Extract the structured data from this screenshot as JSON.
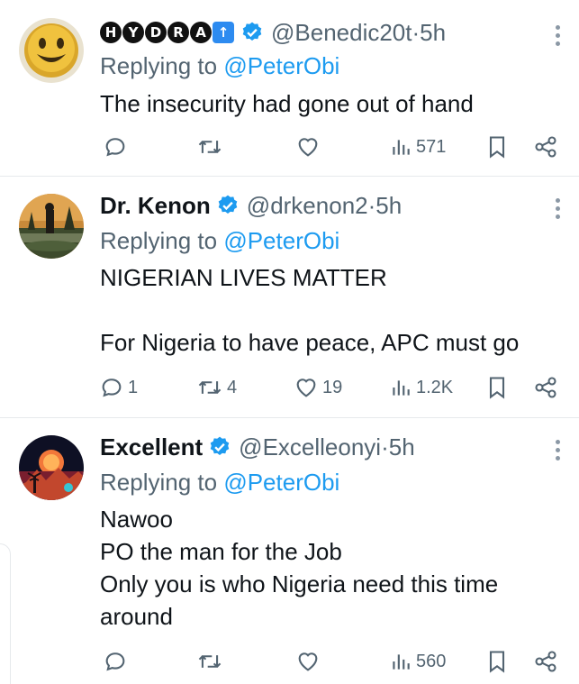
{
  "tweets": [
    {
      "display_name": "",
      "name_badges": [
        "H",
        "Y",
        "D",
        "R",
        "A"
      ],
      "handle": "@Benedic20t",
      "time": "5h",
      "replying_prefix": "Replying to ",
      "replying_to": "@PeterObi",
      "text": "The insecurity had gone out of hand",
      "reply_count": "",
      "retweet_count": "",
      "like_count": "",
      "view_count": "571",
      "avatar_icon": "smiley-face-avatar"
    },
    {
      "display_name": "Dr. Kenon",
      "handle": "@drkenon2",
      "time": "5h",
      "replying_prefix": "Replying to ",
      "replying_to": "@PeterObi",
      "text": "NIGERIAN LIVES MATTER\n\nFor Nigeria to have peace, APC must go",
      "reply_count": "1",
      "retweet_count": "4",
      "like_count": "19",
      "view_count": "1.2K",
      "avatar_icon": "sunset-field-avatar"
    },
    {
      "display_name": "Excellent",
      "handle": "@Excelleonyi",
      "time": "5h",
      "replying_prefix": "Replying to ",
      "replying_to": "@PeterObi",
      "text": "Nawoo\nPO the man for the Job\nOnly you is who Nigeria need this time\naround",
      "reply_count": "",
      "retweet_count": "",
      "like_count": "",
      "view_count": "560",
      "avatar_icon": "night-scene-avatar"
    }
  ],
  "colors": {
    "verified": "#1d9bf0",
    "link": "#1d9bf0",
    "muted": "#536471",
    "text": "#0f1419"
  },
  "separator": " · "
}
